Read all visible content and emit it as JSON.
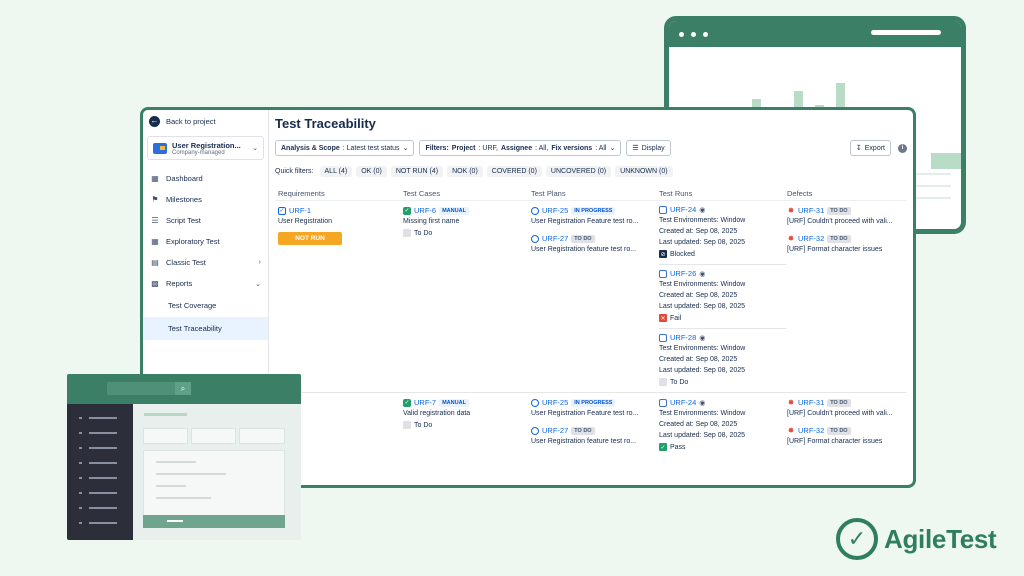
{
  "sidebar": {
    "back_label": "Back to project",
    "project_name": "User Registration...",
    "project_type": "Company-managed",
    "items": [
      {
        "label": "Dashboard"
      },
      {
        "label": "Milestones"
      },
      {
        "label": "Script Test"
      },
      {
        "label": "Exploratory Test"
      },
      {
        "label": "Classic Test"
      },
      {
        "label": "Reports"
      }
    ],
    "sub_items": [
      {
        "label": "Test Coverage"
      },
      {
        "label": "Test Traceability"
      }
    ]
  },
  "page": {
    "title": "Test Traceability"
  },
  "toolbar": {
    "analysis_label": "Analysis & Scope",
    "analysis_value": ": Latest test status",
    "filters_label": "Filters:",
    "filter_project_label": "Project",
    "filter_project_value": ": URF,",
    "filter_assignee_label": "Assignee",
    "filter_assignee_value": ": All,",
    "filter_fix_label": "Fix versions",
    "filter_fix_value": ": All",
    "display_label": "Display",
    "export_label": "Export"
  },
  "quick_filters": {
    "label": "Quick filters:",
    "chips": [
      "ALL (4)",
      "OK (0)",
      "NOT RUN (4)",
      "NOK (0)",
      "COVERED (0)",
      "UNCOVERED (0)",
      "UNKNOWN (0)"
    ]
  },
  "columns": [
    "Requirements",
    "Test Cases",
    "Test Plans",
    "Test Runs",
    "Defects"
  ],
  "requirement": {
    "key": "URF-1",
    "title": "User Registration",
    "status": "NOT RUN"
  },
  "rows": [
    {
      "test_case": {
        "key": "URF-6",
        "badge": "MANUAL",
        "title": "Missing first name",
        "status": "To Do"
      },
      "plans": [
        {
          "key": "URF-25",
          "badge": "IN PROGRESS",
          "title": "User Registration Feature test ro..."
        },
        {
          "key": "URF-27",
          "badge": "TO DO",
          "title": "User Registration feature test ro..."
        }
      ],
      "runs": [
        {
          "key": "URF-24",
          "env": "Test Environments: Window",
          "created": "Created at: Sep 08, 2025",
          "updated": "Last updated: Sep 08, 2025",
          "status": "Blocked"
        },
        {
          "key": "URF-26",
          "env": "Test Environments: Window",
          "created": "Created at: Sep 08, 2025",
          "updated": "Last updated: Sep 08, 2025",
          "status": "Fail"
        },
        {
          "key": "URF-28",
          "env": "Test Environments: Window",
          "created": "Created at: Sep 08, 2025",
          "updated": "Last updated: Sep 08, 2025",
          "status": "To Do"
        }
      ],
      "defects": [
        {
          "key": "URF-31",
          "badge": "TO DO",
          "title": "[URF] Couldn't proceed with vali..."
        },
        {
          "key": "URF-32",
          "badge": "TO DO",
          "title": "[URF] Format character issues"
        }
      ]
    },
    {
      "test_case": {
        "key": "URF-7",
        "badge": "MANUAL",
        "title": "Valid registration data",
        "status": "To Do"
      },
      "plans": [
        {
          "key": "URF-25",
          "badge": "IN PROGRESS",
          "title": "User Registration Feature test ro..."
        },
        {
          "key": "URF-27",
          "badge": "TO DO",
          "title": "User Registration feature test ro..."
        }
      ],
      "runs": [
        {
          "key": "URF-24",
          "env": "Test Environments: Window",
          "created": "Created at: Sep 08, 2025",
          "updated": "Last updated: Sep 08, 2025",
          "status": "Pass"
        }
      ],
      "defects": [
        {
          "key": "URF-31",
          "badge": "TO DO",
          "title": "[URF] Couldn't proceed with vali..."
        },
        {
          "key": "URF-32",
          "badge": "TO DO",
          "title": "[URF] Format character issues"
        }
      ]
    }
  ],
  "logo": {
    "text": "AgileTest"
  }
}
